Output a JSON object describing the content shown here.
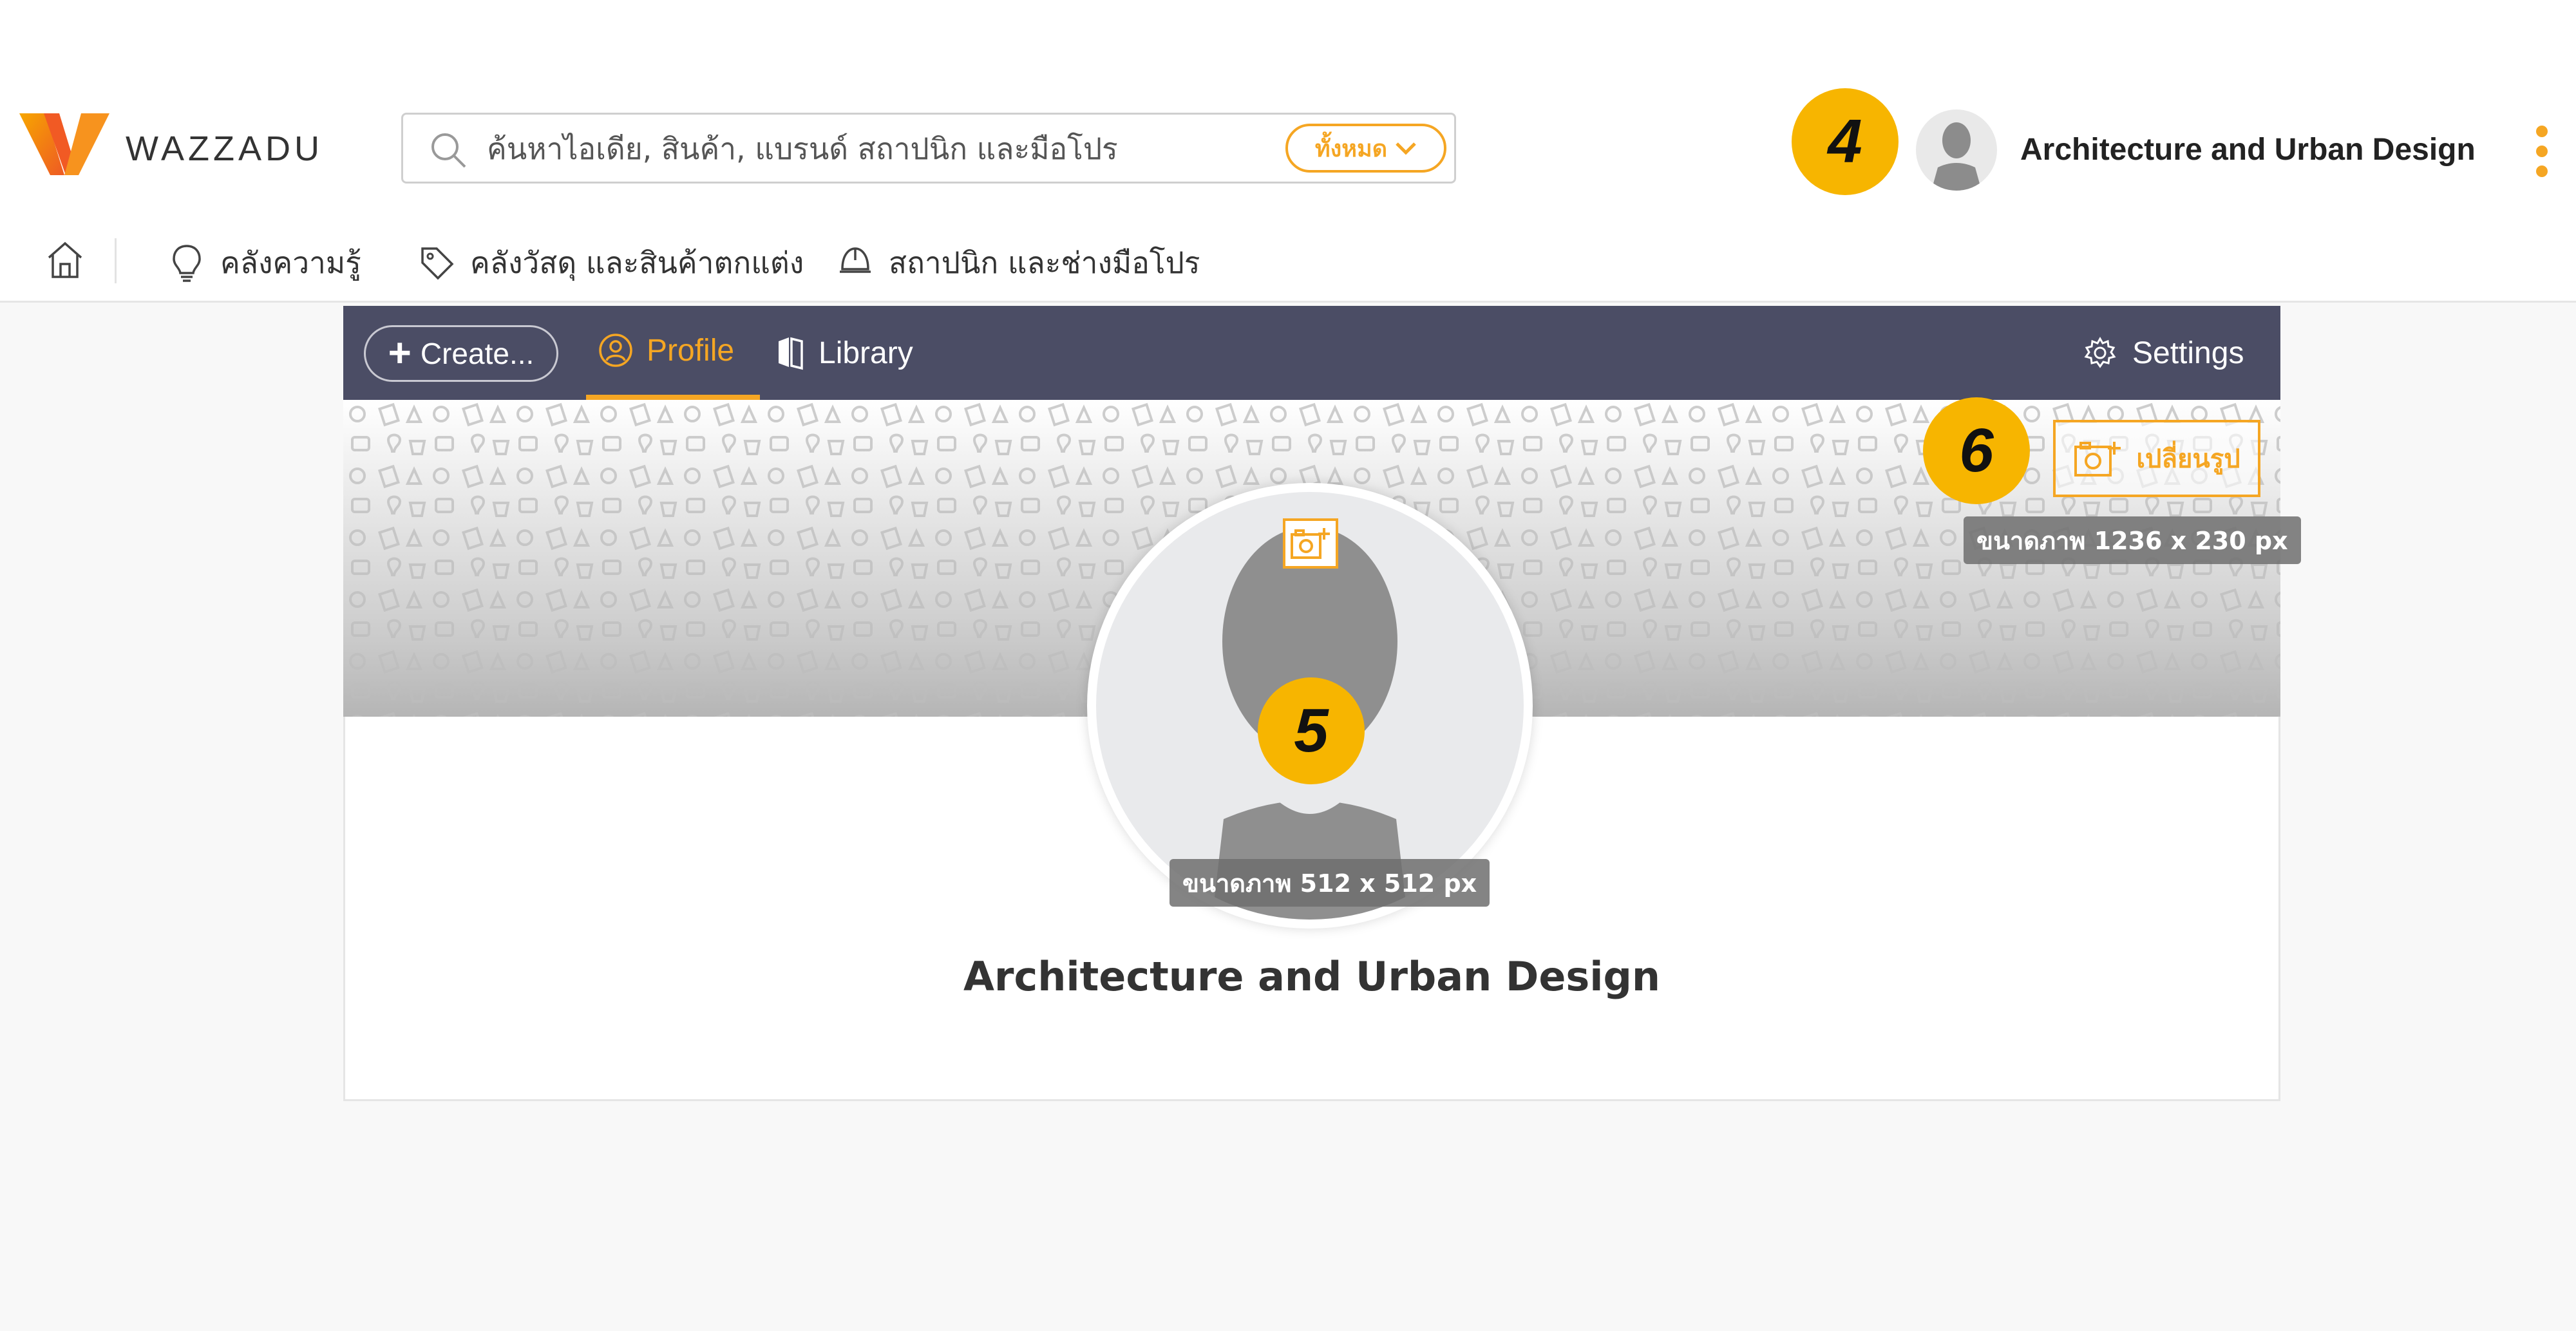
{
  "brand": {
    "name": "WAZZADU"
  },
  "search": {
    "placeholder": "ค้นหาไอเดีย, สินค้า, แบรนด์ สถาปนิก และมือโปร",
    "filter_label": "ทั้งหมด"
  },
  "user": {
    "name": "Architecture and Urban Design"
  },
  "badges": {
    "user_menu": "4",
    "profile_picture": "5",
    "cover_photo": "6"
  },
  "nav": {
    "items": [
      {
        "label": "คลังความรู้",
        "icon": "lightbulb-icon"
      },
      {
        "label": "คลังวัสดุ และสินค้าตกแต่ง",
        "icon": "tag-icon"
      },
      {
        "label": "สถาปนิก และช่างมือโปร",
        "icon": "helmet-icon"
      }
    ]
  },
  "toolbar": {
    "create_label": "Create...",
    "tabs": [
      {
        "label": "Profile",
        "active": true,
        "icon": "profile-icon"
      },
      {
        "label": "Library",
        "active": false,
        "icon": "library-icon"
      }
    ],
    "settings_label": "Settings"
  },
  "cover": {
    "change_label": "เปลี่ยนรูป",
    "size_hint": "ขนาดภาพ 1236 x 230 px"
  },
  "profile_picture": {
    "size_hint": "ขนาดภาพ 512 x 512 px"
  },
  "profile": {
    "display_name": "Architecture and Urban Design"
  },
  "colors": {
    "accent": "#f5a623",
    "badge": "#f7b500",
    "toolbar_bg": "#4b4d65",
    "page_bg": "#f8f8f8"
  }
}
